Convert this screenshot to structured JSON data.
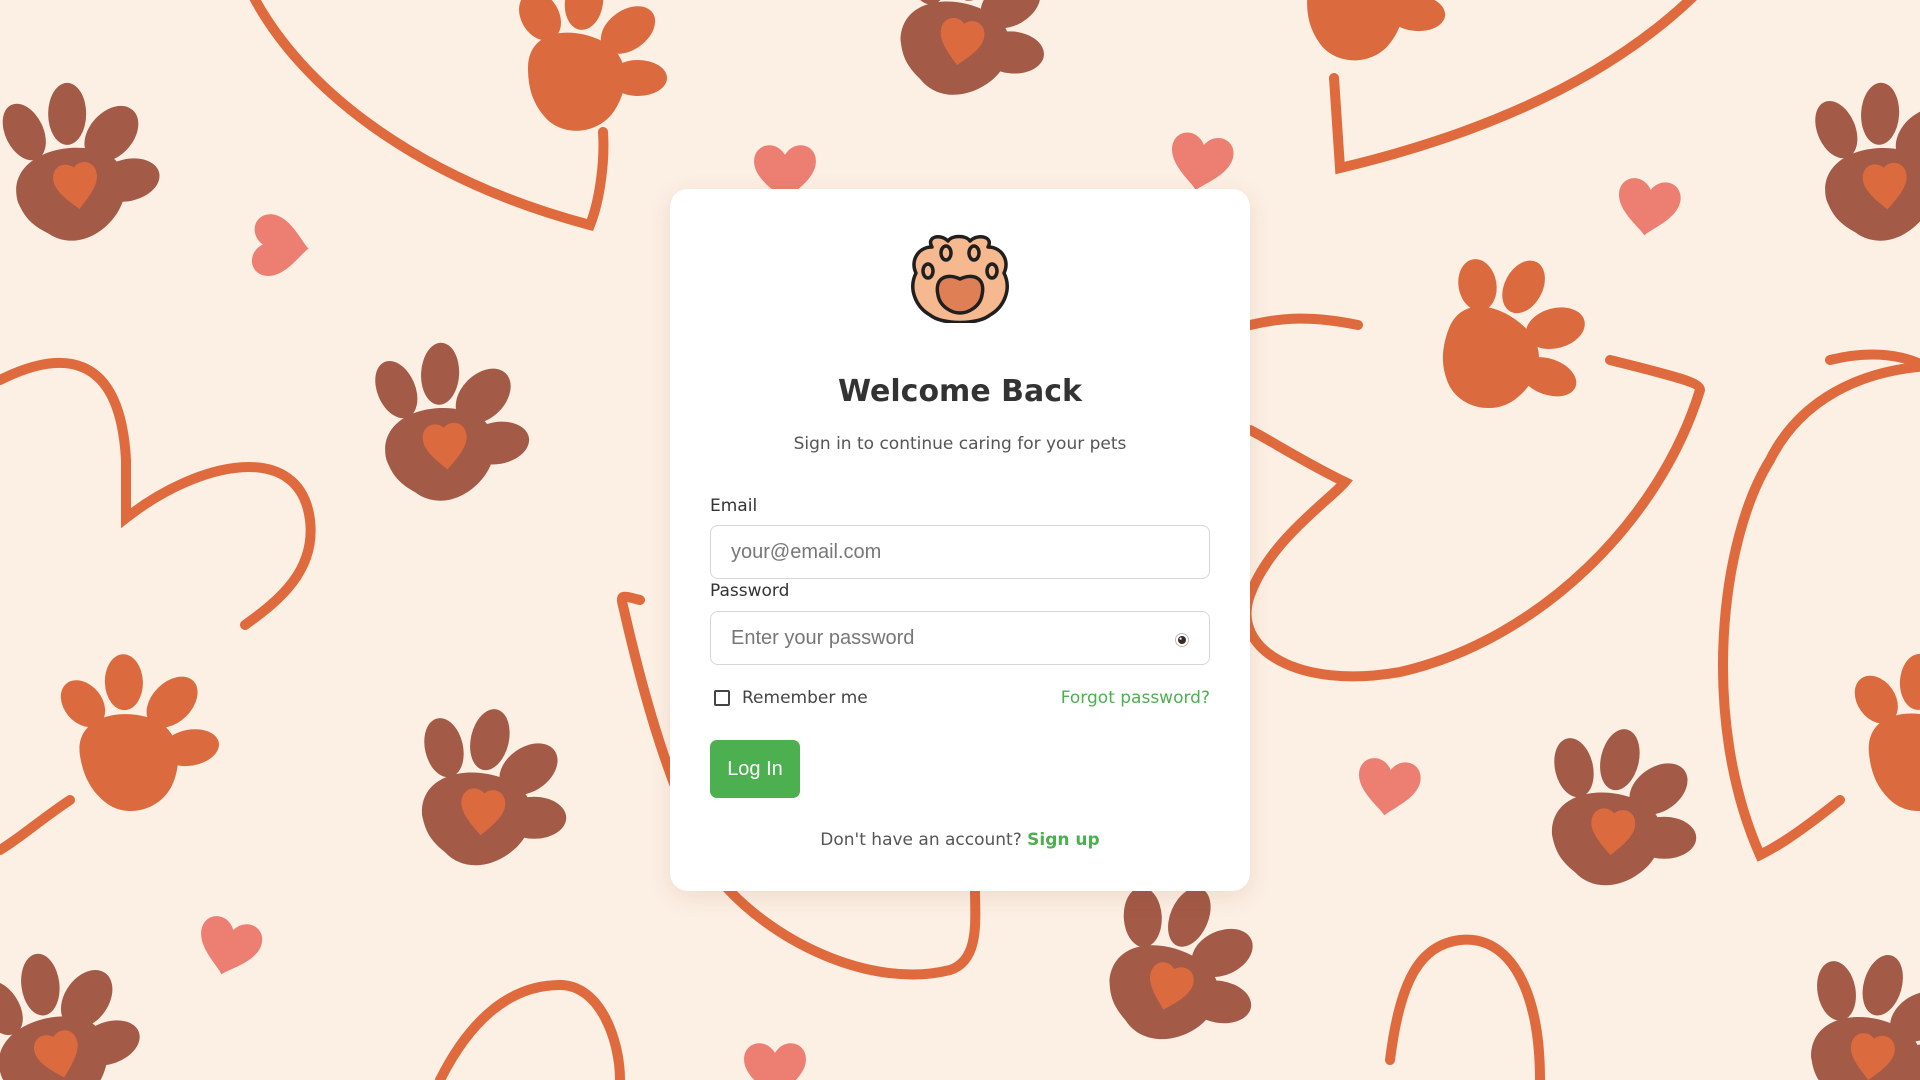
{
  "colors": {
    "background": "#fcefe3",
    "paw_dark": "#a35a47",
    "paw_orange": "#db6a3e",
    "heart_pink": "#ec7f72",
    "line_orange": "#df6a3d",
    "accent_green": "#4caf50",
    "card": "#ffffff"
  },
  "background": {
    "pattern": "paw prints and hearts"
  },
  "logo": {
    "icon": "paw-print-icon"
  },
  "login": {
    "title": "Welcome Back",
    "subtitle": "Sign in to continue caring for your pets",
    "email_label": "Email",
    "email_placeholder": "your@email.com",
    "email_value": "",
    "password_label": "Password",
    "password_placeholder": "Enter your password",
    "password_value": "",
    "show_password_icon": "eye-icon",
    "remember_label": "Remember me",
    "remember_checked": false,
    "forgot_label": "Forgot password?",
    "submit_label": "Log In",
    "signup_prompt": "Don't have an account?",
    "signup_label": "Sign up"
  }
}
